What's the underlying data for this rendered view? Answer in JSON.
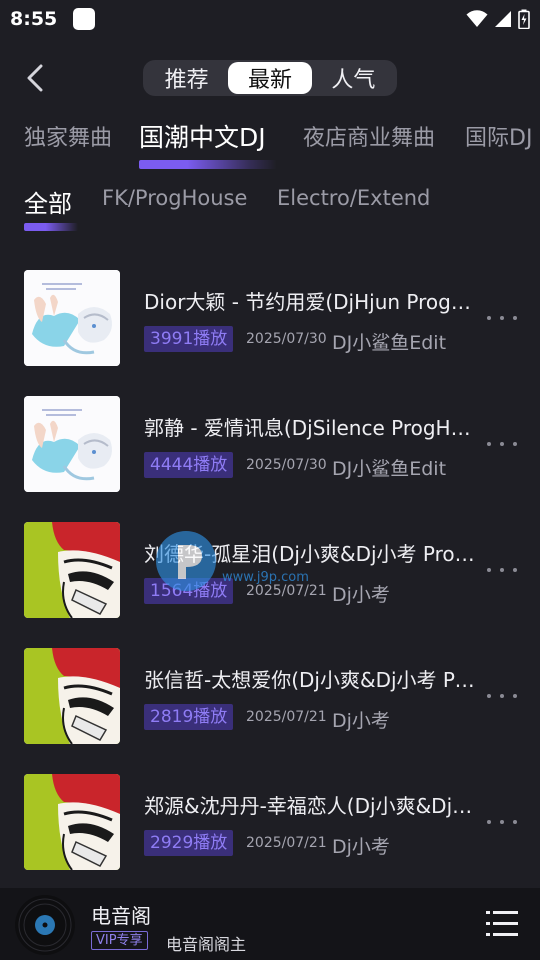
{
  "status": {
    "time": "8:55"
  },
  "header": {
    "tabs": [
      {
        "label": "推荐",
        "active": false
      },
      {
        "label": "最新",
        "active": true
      },
      {
        "label": "人气",
        "active": false
      }
    ]
  },
  "categories": [
    {
      "label": "独家舞曲",
      "active": false
    },
    {
      "label": "国潮中文DJ",
      "active": true
    },
    {
      "label": "夜店商业舞曲",
      "active": false
    },
    {
      "label": "国际DJ",
      "active": false
    }
  ],
  "subcategories": [
    {
      "label": "全部",
      "active": true
    },
    {
      "label": "FK/ProgHouse",
      "active": false
    },
    {
      "label": "Electro/Extend",
      "active": false
    }
  ],
  "songs": [
    {
      "title": "Dior大颖 - 节约用爱(DjHjun ProgHouse Mix)",
      "plays": "3991播放",
      "date": "2025/07/30",
      "artist": "DJ小鲨鱼Edit",
      "cover": "anime-girl-cover"
    },
    {
      "title": "郭静 - 爱情讯息(DjSilence ProgHouse Mix)",
      "plays": "4444播放",
      "date": "2025/07/30",
      "artist": "DJ小鲨鱼Edit",
      "cover": "anime-girl-cover"
    },
    {
      "title": "刘德华-孤星泪(Dj小爽&Dj小考 ProgHouse Mix)",
      "plays": "1564播放",
      "date": "2025/07/21",
      "artist": "Dj小考",
      "cover": "mustache-man-cover"
    },
    {
      "title": "张信哲-太想爱你(Dj小爽&Dj小考 ProgHouse Mix)",
      "plays": "2819播放",
      "date": "2025/07/21",
      "artist": "Dj小考",
      "cover": "mustache-man-cover"
    },
    {
      "title": "郑源&沈丹丹-幸福恋人(Dj小爽&Dj小考 ProgHouse Mix)",
      "plays": "2929播放",
      "date": "2025/07/21",
      "artist": "Dj小考",
      "cover": "mustache-man-cover"
    }
  ],
  "watermark": {
    "domain": "www.j9p.com"
  },
  "player": {
    "title": "电音阁",
    "vip_label": "VIP专享",
    "subtitle": "电音阁阁主"
  },
  "colors": {
    "background": "#1e1e24",
    "accent": "#7b5cf0",
    "badge_bg": "#3a2f7a",
    "badge_text": "#8f7cf5",
    "player_bg": "#141418"
  }
}
